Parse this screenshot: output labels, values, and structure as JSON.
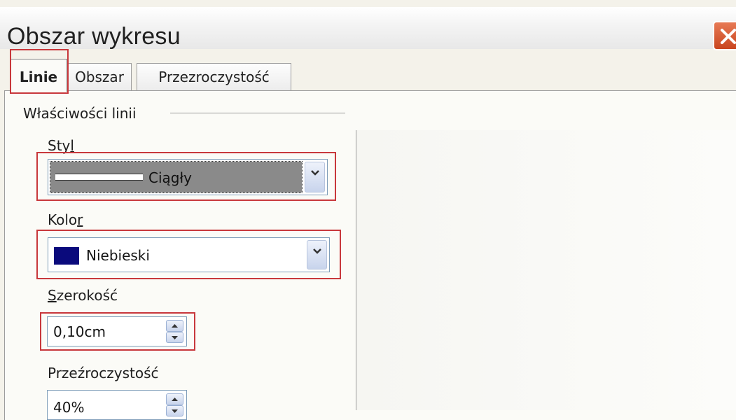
{
  "window": {
    "title": "Obszar wykresu",
    "close_icon": "close-icon",
    "close_color": "#d25a36"
  },
  "tabs": [
    {
      "label": "Linie",
      "active": true
    },
    {
      "label": "Obszar",
      "active": false
    },
    {
      "label": "Przezroczystość",
      "active": false
    }
  ],
  "line_properties": {
    "group_label": "Właściwości linii",
    "style": {
      "label_a": "Sty",
      "label_u": "l",
      "value": "Ciągły"
    },
    "color": {
      "label_a": "Kolo",
      "label_u": "r",
      "value": "Niebieski",
      "swatch": "#0a0a7c"
    },
    "width": {
      "label_u": "S",
      "label_b": "zerokość",
      "value": "0,10cm"
    },
    "transparency": {
      "label": "Przeźroczystość",
      "value": "40%"
    }
  },
  "accent_colors": {
    "highlight": "#c8383c",
    "selection": "#8a8a8a"
  }
}
